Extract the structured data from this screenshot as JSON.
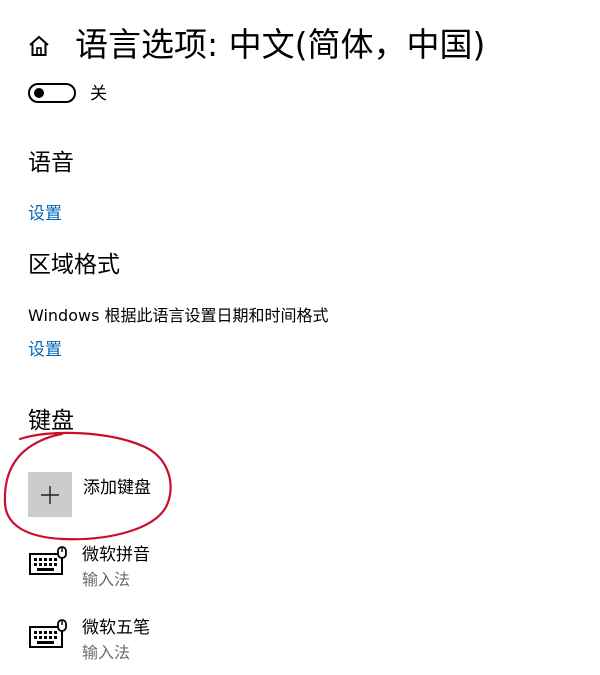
{
  "header": {
    "title": "语言选项: 中文(简体，中国)",
    "home_icon": "home-icon"
  },
  "toggle": {
    "state": "off",
    "label": "关"
  },
  "speech": {
    "title": "语音",
    "link": "设置"
  },
  "region": {
    "title": "区域格式",
    "description": "Windows 根据此语言设置日期和时间格式",
    "link": "设置"
  },
  "keyboards": {
    "title": "键盘",
    "add_label": "添加键盘",
    "add_icon": "plus-icon",
    "items": [
      {
        "name": "微软拼音",
        "type": "输入法",
        "icon": "keyboard-icon"
      },
      {
        "name": "微软五笔",
        "type": "输入法",
        "icon": "keyboard-icon"
      }
    ]
  },
  "colors": {
    "link": "#0067b8",
    "tile_bg": "#cccccc",
    "secondary_text": "#6b6b6b",
    "annotation": "#c8102e"
  }
}
